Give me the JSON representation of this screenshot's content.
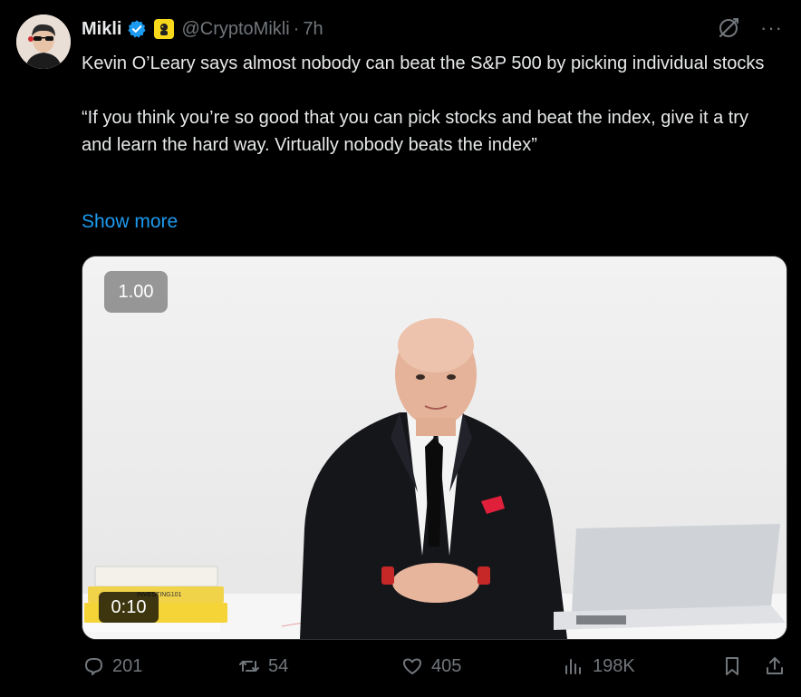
{
  "author": {
    "name": "Mikli",
    "handle": "@CryptoMikli",
    "time": "7h"
  },
  "tweet": {
    "line1": "Kevin O’Leary says almost nobody can beat the S&P 500 by picking individual stocks",
    "quote": "“If you think you’re so good that you can pick stocks and beat the index, give it a try and learn the hard way. Virtually nobody beats the index”",
    "show_more": "Show more"
  },
  "media": {
    "speed": "1.00",
    "duration": "0:10",
    "book_text": "INVESTING101"
  },
  "actions": {
    "replies": "201",
    "reposts": "54",
    "likes": "405",
    "views": "198K"
  },
  "colors": {
    "background": "#000000",
    "text": "#e7e9ea",
    "muted": "#71767b",
    "link": "#1d9bf0",
    "verified": "#1d9bf0"
  },
  "icons": [
    "grok-icon",
    "more-icon",
    "reply-icon",
    "repost-icon",
    "like-icon",
    "views-icon",
    "bookmark-icon",
    "share-icon",
    "verified-icon"
  ]
}
